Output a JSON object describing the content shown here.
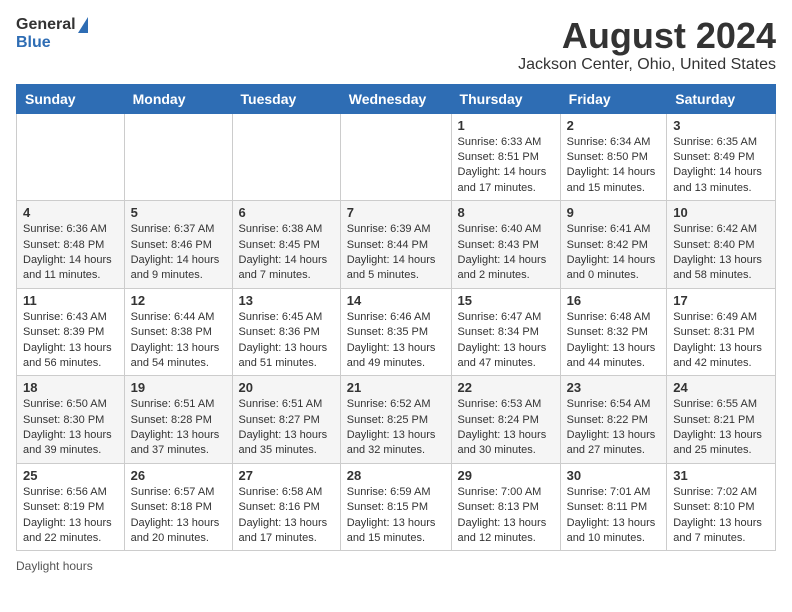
{
  "header": {
    "logo_general": "General",
    "logo_blue": "Blue",
    "title": "August 2024",
    "subtitle": "Jackson Center, Ohio, United States"
  },
  "days_of_week": [
    "Sunday",
    "Monday",
    "Tuesday",
    "Wednesday",
    "Thursday",
    "Friday",
    "Saturday"
  ],
  "weeks": [
    [
      {
        "day": "",
        "info": ""
      },
      {
        "day": "",
        "info": ""
      },
      {
        "day": "",
        "info": ""
      },
      {
        "day": "",
        "info": ""
      },
      {
        "day": "1",
        "info": "Sunrise: 6:33 AM\nSunset: 8:51 PM\nDaylight: 14 hours and 17 minutes."
      },
      {
        "day": "2",
        "info": "Sunrise: 6:34 AM\nSunset: 8:50 PM\nDaylight: 14 hours and 15 minutes."
      },
      {
        "day": "3",
        "info": "Sunrise: 6:35 AM\nSunset: 8:49 PM\nDaylight: 14 hours and 13 minutes."
      }
    ],
    [
      {
        "day": "4",
        "info": "Sunrise: 6:36 AM\nSunset: 8:48 PM\nDaylight: 14 hours and 11 minutes."
      },
      {
        "day": "5",
        "info": "Sunrise: 6:37 AM\nSunset: 8:46 PM\nDaylight: 14 hours and 9 minutes."
      },
      {
        "day": "6",
        "info": "Sunrise: 6:38 AM\nSunset: 8:45 PM\nDaylight: 14 hours and 7 minutes."
      },
      {
        "day": "7",
        "info": "Sunrise: 6:39 AM\nSunset: 8:44 PM\nDaylight: 14 hours and 5 minutes."
      },
      {
        "day": "8",
        "info": "Sunrise: 6:40 AM\nSunset: 8:43 PM\nDaylight: 14 hours and 2 minutes."
      },
      {
        "day": "9",
        "info": "Sunrise: 6:41 AM\nSunset: 8:42 PM\nDaylight: 14 hours and 0 minutes."
      },
      {
        "day": "10",
        "info": "Sunrise: 6:42 AM\nSunset: 8:40 PM\nDaylight: 13 hours and 58 minutes."
      }
    ],
    [
      {
        "day": "11",
        "info": "Sunrise: 6:43 AM\nSunset: 8:39 PM\nDaylight: 13 hours and 56 minutes."
      },
      {
        "day": "12",
        "info": "Sunrise: 6:44 AM\nSunset: 8:38 PM\nDaylight: 13 hours and 54 minutes."
      },
      {
        "day": "13",
        "info": "Sunrise: 6:45 AM\nSunset: 8:36 PM\nDaylight: 13 hours and 51 minutes."
      },
      {
        "day": "14",
        "info": "Sunrise: 6:46 AM\nSunset: 8:35 PM\nDaylight: 13 hours and 49 minutes."
      },
      {
        "day": "15",
        "info": "Sunrise: 6:47 AM\nSunset: 8:34 PM\nDaylight: 13 hours and 47 minutes."
      },
      {
        "day": "16",
        "info": "Sunrise: 6:48 AM\nSunset: 8:32 PM\nDaylight: 13 hours and 44 minutes."
      },
      {
        "day": "17",
        "info": "Sunrise: 6:49 AM\nSunset: 8:31 PM\nDaylight: 13 hours and 42 minutes."
      }
    ],
    [
      {
        "day": "18",
        "info": "Sunrise: 6:50 AM\nSunset: 8:30 PM\nDaylight: 13 hours and 39 minutes."
      },
      {
        "day": "19",
        "info": "Sunrise: 6:51 AM\nSunset: 8:28 PM\nDaylight: 13 hours and 37 minutes."
      },
      {
        "day": "20",
        "info": "Sunrise: 6:51 AM\nSunset: 8:27 PM\nDaylight: 13 hours and 35 minutes."
      },
      {
        "day": "21",
        "info": "Sunrise: 6:52 AM\nSunset: 8:25 PM\nDaylight: 13 hours and 32 minutes."
      },
      {
        "day": "22",
        "info": "Sunrise: 6:53 AM\nSunset: 8:24 PM\nDaylight: 13 hours and 30 minutes."
      },
      {
        "day": "23",
        "info": "Sunrise: 6:54 AM\nSunset: 8:22 PM\nDaylight: 13 hours and 27 minutes."
      },
      {
        "day": "24",
        "info": "Sunrise: 6:55 AM\nSunset: 8:21 PM\nDaylight: 13 hours and 25 minutes."
      }
    ],
    [
      {
        "day": "25",
        "info": "Sunrise: 6:56 AM\nSunset: 8:19 PM\nDaylight: 13 hours and 22 minutes."
      },
      {
        "day": "26",
        "info": "Sunrise: 6:57 AM\nSunset: 8:18 PM\nDaylight: 13 hours and 20 minutes."
      },
      {
        "day": "27",
        "info": "Sunrise: 6:58 AM\nSunset: 8:16 PM\nDaylight: 13 hours and 17 minutes."
      },
      {
        "day": "28",
        "info": "Sunrise: 6:59 AM\nSunset: 8:15 PM\nDaylight: 13 hours and 15 minutes."
      },
      {
        "day": "29",
        "info": "Sunrise: 7:00 AM\nSunset: 8:13 PM\nDaylight: 13 hours and 12 minutes."
      },
      {
        "day": "30",
        "info": "Sunrise: 7:01 AM\nSunset: 8:11 PM\nDaylight: 13 hours and 10 minutes."
      },
      {
        "day": "31",
        "info": "Sunrise: 7:02 AM\nSunset: 8:10 PM\nDaylight: 13 hours and 7 minutes."
      }
    ]
  ],
  "footer": {
    "note": "Daylight hours"
  }
}
